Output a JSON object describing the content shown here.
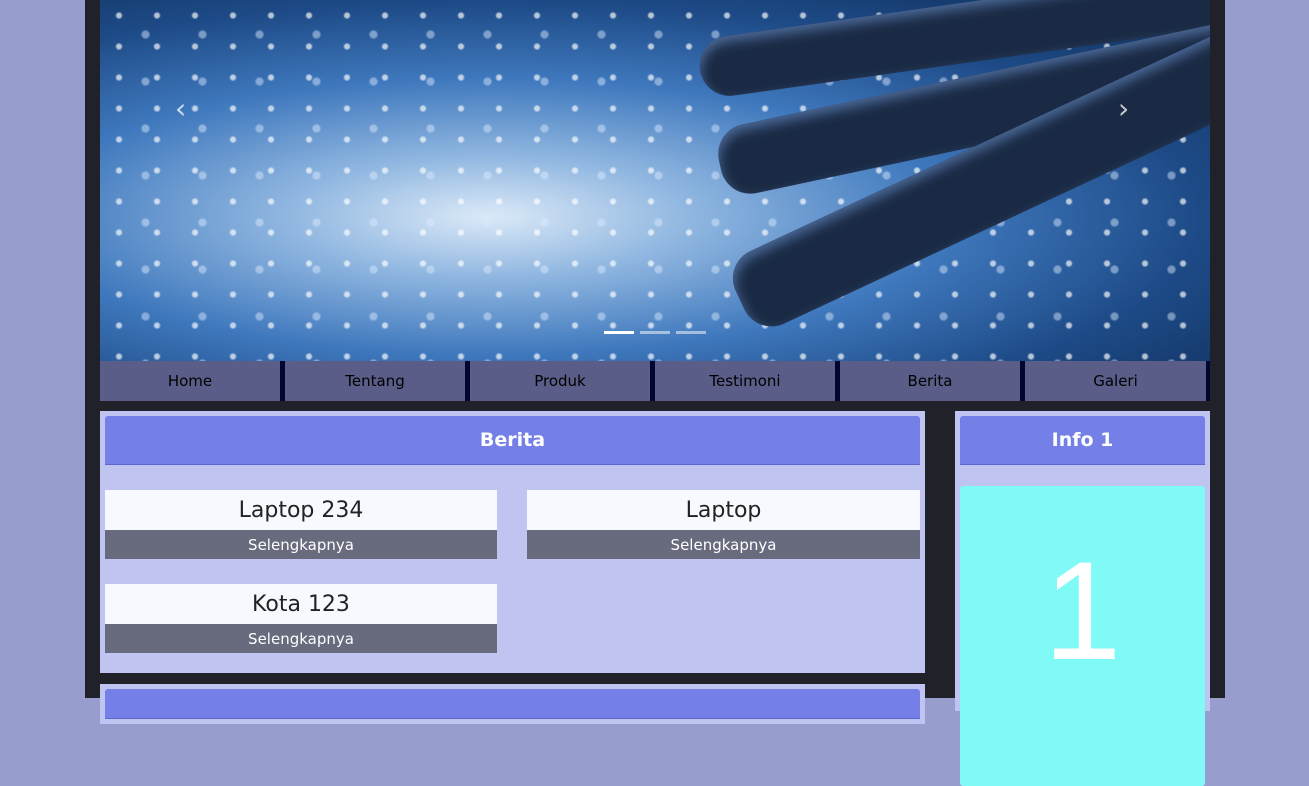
{
  "slider": {
    "prev_icon": "chevron-left-icon",
    "next_icon": "chevron-right-icon",
    "prev": "‹",
    "next": "›",
    "slides": 3,
    "active": 1
  },
  "nav": [
    "Home",
    "Tentang",
    "Produk",
    "Testimoni",
    "Berita",
    "Galeri"
  ],
  "berita": {
    "title": "Berita",
    "items": [
      {
        "title": "Laptop 234",
        "button": "Selengkapnya"
      },
      {
        "title": "Laptop",
        "button": "Selengkapnya"
      },
      {
        "title": "Kota 123",
        "button": "Selengkapnya"
      }
    ]
  },
  "info": {
    "title": "Info 1",
    "value": "1"
  },
  "colors": {
    "background": "#979dcd",
    "header": "#7480e8",
    "panel": "#c0c4f0",
    "info_box": "#7ffaf7"
  }
}
